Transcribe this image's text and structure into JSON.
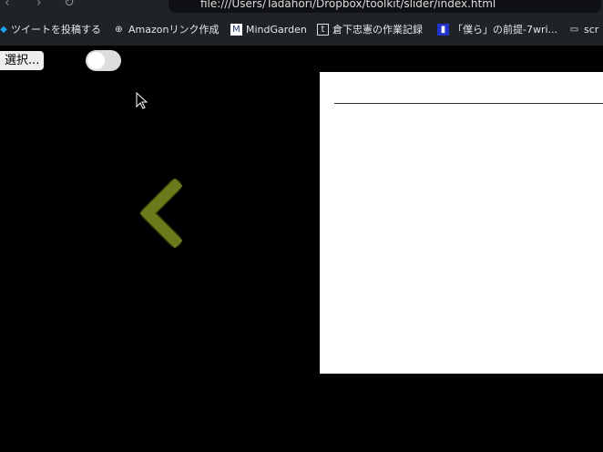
{
  "browser": {
    "url": "file:///Users/Tadahori/Dropbox/toolkit/slider/index.html"
  },
  "bookmarks": [
    {
      "label": "ツイートを投稿する",
      "icon": "twitter-icon"
    },
    {
      "label": "Amazonリンク作成",
      "icon": "globe-icon"
    },
    {
      "label": "MindGarden",
      "icon": "mindgarden-icon"
    },
    {
      "label": "倉下忠憲の作業記録",
      "icon": "t-icon"
    },
    {
      "label": "「僕ら」の前提-7wri...",
      "icon": "book-icon"
    },
    {
      "label": "scr",
      "icon": "folder-icon"
    }
  ],
  "page": {
    "file_button": "選択...",
    "toggle_on": false
  }
}
